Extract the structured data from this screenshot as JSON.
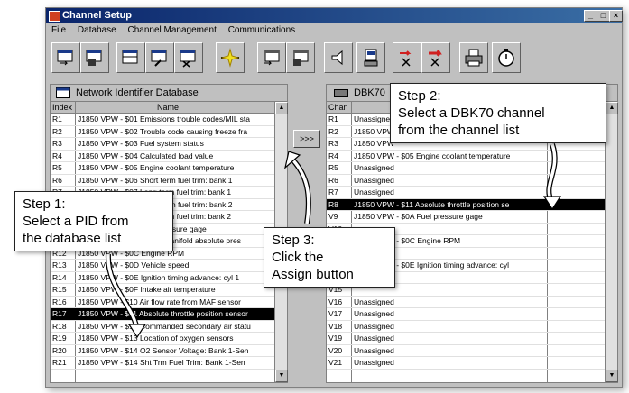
{
  "window": {
    "title": "Channel Setup"
  },
  "menu": [
    "File",
    "Database",
    "Channel Management",
    "Communications"
  ],
  "toolbar": {
    "icons": [
      "import-icon",
      "save-icon",
      "table-icon",
      "table-edit-icon",
      "table-delete-icon",
      "flash-icon",
      "export-icon",
      "save-disk-icon",
      "speaker-icon",
      "device-icon",
      "delete-red-icon",
      "delete-arrow-icon",
      "printer-icon",
      "clock-icon"
    ]
  },
  "left_panel": {
    "title": "Network Identifier Database",
    "col_index": "Index",
    "col_name": "Name",
    "rows": [
      {
        "idx": "R1",
        "name": "J1850 VPW - $01 Emissions trouble codes/MIL sta"
      },
      {
        "idx": "R2",
        "name": "J1850 VPW - $02 Trouble code causing freeze fra"
      },
      {
        "idx": "R3",
        "name": "J1850 VPW - $03 Fuel system status"
      },
      {
        "idx": "R4",
        "name": "J1850 VPW - $04 Calculated load value"
      },
      {
        "idx": "R5",
        "name": "J1850 VPW - $05 Engine coolant temperature"
      },
      {
        "idx": "R6",
        "name": "J1850 VPW - $06 Short term fuel trim: bank 1"
      },
      {
        "idx": "R7",
        "name": "J1850 VPW - $07 Long term fuel trim: bank 1"
      },
      {
        "idx": "R8",
        "name": "J1850 VPW - $08 Short term fuel trim: bank 2"
      },
      {
        "idx": "R9",
        "name": "J1850 VPW - $09 Long term fuel trim: bank 2"
      },
      {
        "idx": "R10",
        "name": "J1850 VPW - $0A Fuel pressure gage"
      },
      {
        "idx": "R11",
        "name": "J1850 VPW - $0B Intake manifold absolute pres"
      },
      {
        "idx": "R12",
        "name": "J1850 VPW - $0C Engine RPM"
      },
      {
        "idx": "R13",
        "name": "J1850 VPW - $0D Vehicle speed"
      },
      {
        "idx": "R14",
        "name": "J1850 VPW - $0E Ignition timing advance: cyl 1"
      },
      {
        "idx": "R15",
        "name": "J1850 VPW - $0F Intake air temperature"
      },
      {
        "idx": "R16",
        "name": "J1850 VPW - $10 Air flow rate from MAF sensor"
      },
      {
        "idx": "R17",
        "name": "J1850 VPW - $11 Absolute throttle position sensor",
        "selected": true
      },
      {
        "idx": "R18",
        "name": "J1850 VPW - $12 Commanded secondary air statu"
      },
      {
        "idx": "R19",
        "name": "J1850 VPW - $13 Location of oxygen sensors"
      },
      {
        "idx": "R20",
        "name": "J1850 VPW - $14 O2 Sensor Voltage: Bank 1-Sen"
      },
      {
        "idx": "R21",
        "name": "J1850 VPW - $14 Sht Trm Fuel Trim: Bank 1-Sen"
      }
    ]
  },
  "assign_button": {
    "label": ">>>"
  },
  "right_panel": {
    "title": "DBK70",
    "col_chan": "Chan",
    "rows": [
      {
        "idx": "R1",
        "name": "Unassigned"
      },
      {
        "idx": "R2",
        "name": "J1850 VPW"
      },
      {
        "idx": "R3",
        "name": "J1850 VPW"
      },
      {
        "idx": "R4",
        "name": "J1850 VPW - $05 Engine coolant temperature"
      },
      {
        "idx": "R5",
        "name": "Unassigned"
      },
      {
        "idx": "R6",
        "name": "Unassigned"
      },
      {
        "idx": "R7",
        "name": "Unassigned"
      },
      {
        "idx": "R8",
        "name": "J1850 VPW - $11 Absolute throttle position se",
        "selected": true
      },
      {
        "idx": "V9",
        "name": "J1850 VPW - $0A Fuel pressure gage"
      },
      {
        "idx": "V10",
        "name": ""
      },
      {
        "idx": "V11",
        "name": "J1850 VPW - $0C Engine RPM"
      },
      {
        "idx": "V12",
        "name": ""
      },
      {
        "idx": "V13",
        "name": "J1850 VPW - $0E Ignition timing advance: cyl"
      },
      {
        "idx": "V14",
        "name": ""
      },
      {
        "idx": "V15",
        "name": ""
      },
      {
        "idx": "V16",
        "name": "Unassigned"
      },
      {
        "idx": "V17",
        "name": "Unassigned"
      },
      {
        "idx": "V18",
        "name": "Unassigned"
      },
      {
        "idx": "V19",
        "name": "Unassigned"
      },
      {
        "idx": "V20",
        "name": "Unassigned"
      },
      {
        "idx": "V21",
        "name": "Unassigned"
      }
    ]
  },
  "callouts": {
    "step1": [
      "Step 1:",
      "Select a PID from",
      "the database list"
    ],
    "step2": [
      "Step 2:",
      "Select a DBK70 channel",
      "from the channel list"
    ],
    "step3": [
      "Step 3:",
      "Click the",
      "Assign button"
    ]
  }
}
